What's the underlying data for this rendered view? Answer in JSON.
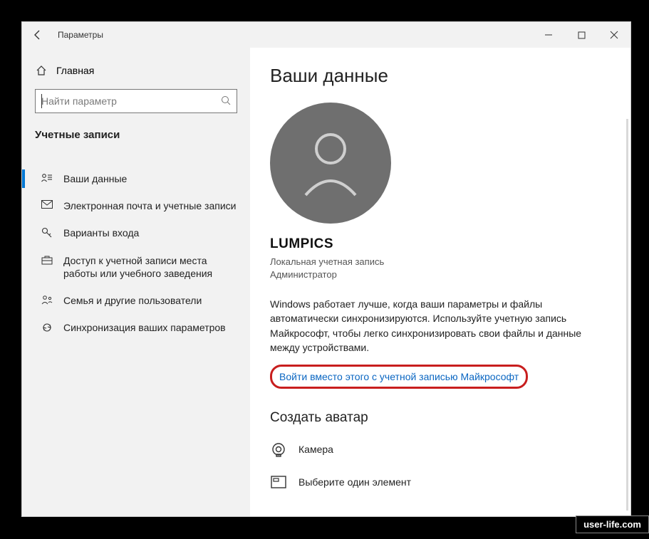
{
  "window": {
    "title": "Параметры"
  },
  "sidebar": {
    "home": "Главная",
    "search_placeholder": "Найти параметр",
    "category": "Учетные записи",
    "items": [
      {
        "label": "Ваши данные"
      },
      {
        "label": "Электронная почта и учетные записи"
      },
      {
        "label": "Варианты входа"
      },
      {
        "label": "Доступ к учетной записи места работы или учебного заведения"
      },
      {
        "label": "Семья и другие пользователи"
      },
      {
        "label": "Синхронизация ваших параметров"
      }
    ]
  },
  "main": {
    "title": "Ваши данные",
    "user": {
      "name": "LUMPICS",
      "account_type": "Локальная учетная запись",
      "role": "Администратор"
    },
    "sync_blurb": "Windows работает лучше, когда ваши параметры и файлы автоматически синхронизируются. Используйте учетную запись Майкрософт, чтобы легко синхронизировать свои файлы и данные между устройствами.",
    "signin_link": "Войти вместо этого с учетной записью Майкрософт",
    "avatar_section": {
      "heading": "Создать аватар",
      "camera": "Камера",
      "choose": "Выберите один элемент"
    }
  },
  "watermark": "user-life.com"
}
